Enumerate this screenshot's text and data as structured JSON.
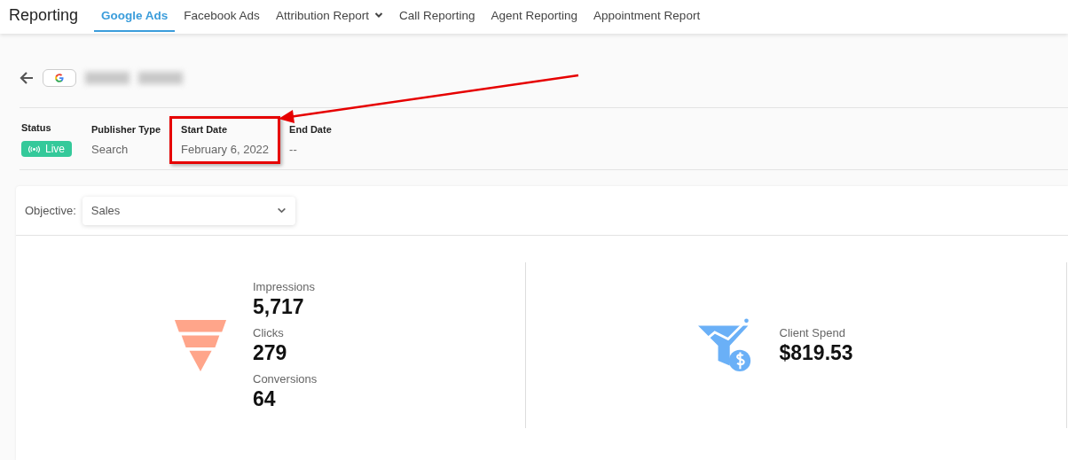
{
  "header": {
    "title": "Reporting"
  },
  "tabs": [
    {
      "label": "Google Ads",
      "selected": true,
      "has_menu": false
    },
    {
      "label": "Facebook Ads",
      "selected": false,
      "has_menu": false
    },
    {
      "label": "Attribution Report",
      "selected": false,
      "has_menu": true
    },
    {
      "label": "Call Reporting",
      "selected": false,
      "has_menu": false
    },
    {
      "label": "Agent Reporting",
      "selected": false,
      "has_menu": false
    },
    {
      "label": "Appointment Report",
      "selected": false,
      "has_menu": false
    }
  ],
  "campaign": {
    "name_redacted": true
  },
  "fields": [
    {
      "label": "Status",
      "value": "Live",
      "kind": "badge",
      "highlighted": false
    },
    {
      "label": "Publisher Type",
      "value": "Search",
      "kind": "text",
      "highlighted": false
    },
    {
      "label": "Start Date",
      "value": "February 6, 2022",
      "kind": "text",
      "highlighted": true
    },
    {
      "label": "End Date",
      "value": "--",
      "kind": "text",
      "highlighted": false
    }
  ],
  "objective": {
    "label": "Objective:",
    "value": "Sales"
  },
  "panels": [
    {
      "kind": "funnel",
      "metrics": [
        {
          "label": "Impressions",
          "value": "5,717"
        },
        {
          "label": "Clicks",
          "value": "279"
        },
        {
          "label": "Conversions",
          "value": "64"
        }
      ]
    },
    {
      "kind": "spend",
      "metrics": [
        {
          "label": "Client Spend",
          "value": "$819.53"
        }
      ]
    }
  ]
}
